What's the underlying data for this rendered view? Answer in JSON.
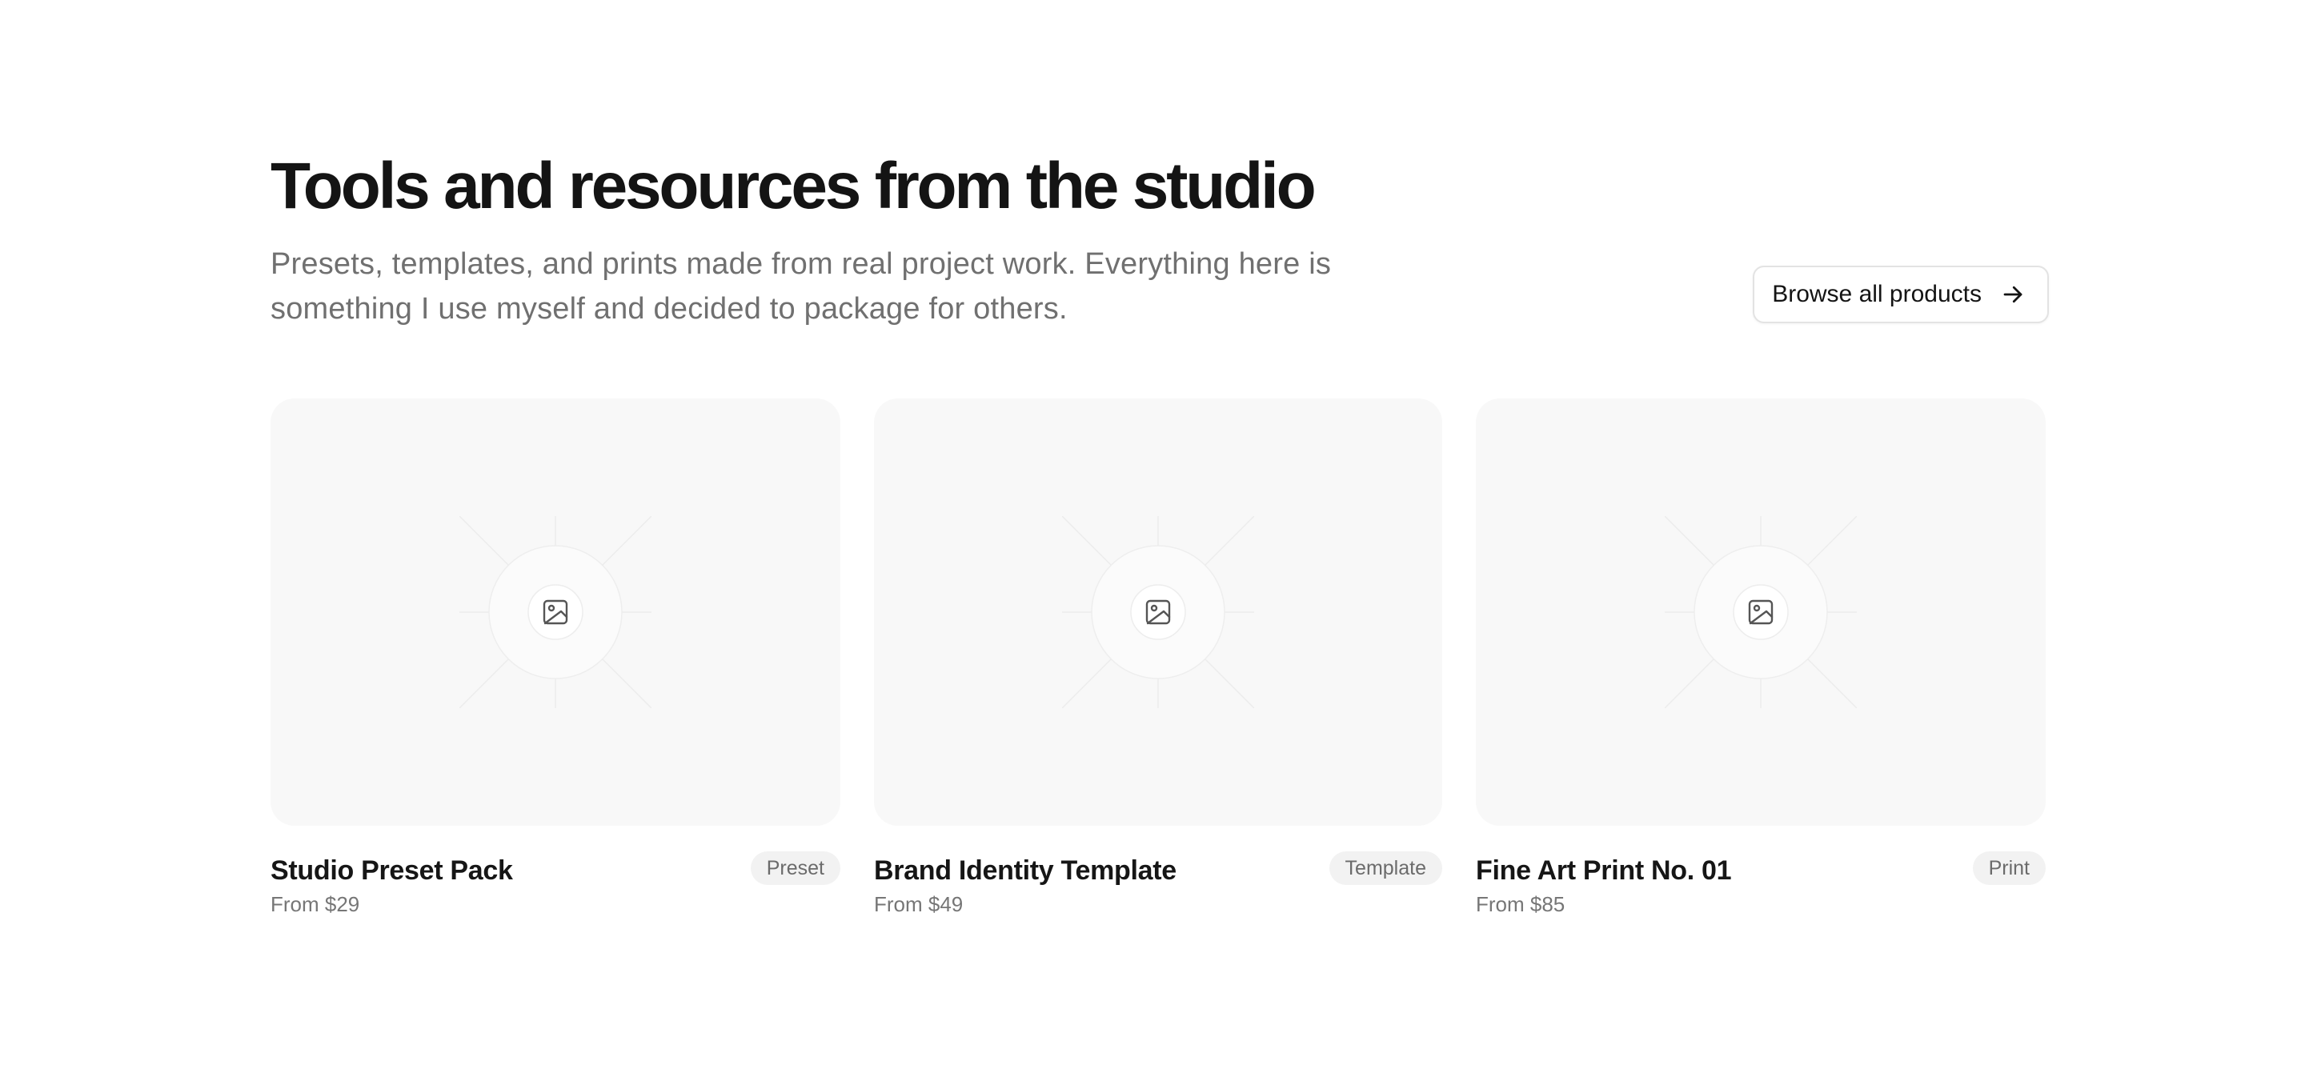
{
  "section": {
    "title": "Tools and resources from the studio",
    "subtitle": "Presets, templates, and prints made from real project work. Everything here is something I use myself and decided to package for others.",
    "browse_label": "Browse all products",
    "browse_icon": "arrow-right-icon"
  },
  "products": [
    {
      "name": "Studio Preset Pack",
      "price": "From $29",
      "category": "Preset",
      "image_icon": "image-placeholder-icon"
    },
    {
      "name": "Brand Identity Template",
      "price": "From $49",
      "category": "Template",
      "image_icon": "image-placeholder-icon"
    },
    {
      "name": "Fine Art Print No. 01",
      "price": "From $85",
      "category": "Print",
      "image_icon": "image-placeholder-icon"
    }
  ],
  "colors": {
    "background": "#ffffff",
    "thumbnail_bg": "#f8f8f8",
    "badge_bg": "#f2f2f2",
    "muted_text": "#707070",
    "title_text": "#141414"
  }
}
